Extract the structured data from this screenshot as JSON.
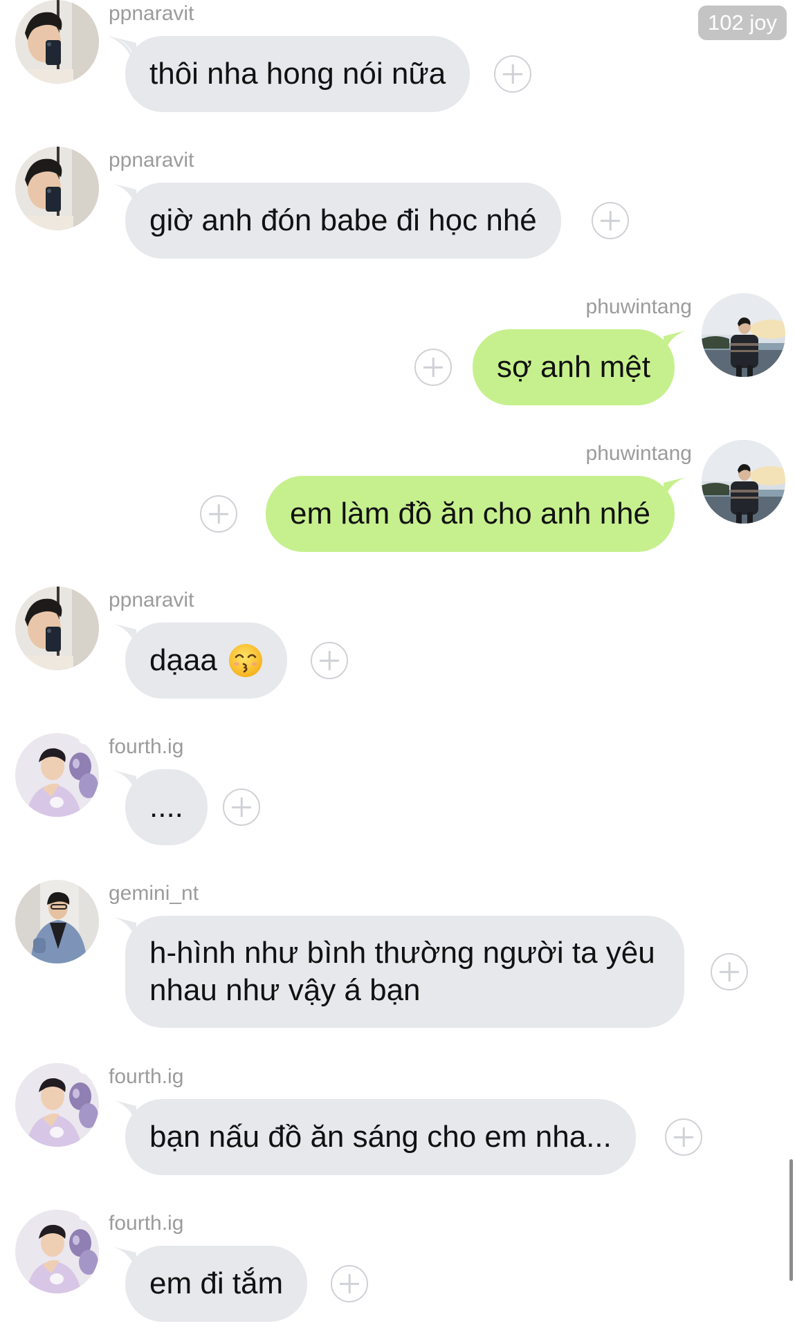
{
  "badge": {
    "text": "102 joy"
  },
  "messages": [
    {
      "user": "ppnaravit",
      "text": "thôi nha hong nói nữa",
      "side": "left",
      "avatar": "ppnaravit-avatar"
    },
    {
      "user": "ppnaravit",
      "text": "giờ anh đón babe đi học nhé",
      "side": "left",
      "avatar": "ppnaravit-avatar"
    },
    {
      "user": "phuwintang",
      "text": "sợ anh mệt",
      "side": "right",
      "avatar": "phuwintang-avatar"
    },
    {
      "user": "phuwintang",
      "text": "em làm đồ ăn cho anh nhé",
      "side": "right",
      "avatar": "phuwintang-avatar"
    },
    {
      "user": "ppnaravit",
      "text": "dạaa",
      "emoji": "kissing-face-with-smiling-eyes",
      "side": "left",
      "avatar": "ppnaravit-avatar"
    },
    {
      "user": "fourth.ig",
      "text": "....",
      "side": "left",
      "avatar": "fourth-avatar"
    },
    {
      "user": "gemini_nt",
      "text": "h-hình như bình thường người ta yêu nhau như vậy á bạn",
      "side": "left",
      "avatar": "gemini-avatar"
    },
    {
      "user": "fourth.ig",
      "text": "bạn nấu đồ ăn sáng cho em nha...",
      "side": "left",
      "avatar": "fourth-avatar"
    },
    {
      "user": "fourth.ig",
      "text": "em đi tắm",
      "side": "left",
      "avatar": "fourth-avatar"
    }
  ],
  "colors": {
    "incoming_bubble": "#e6e8ec",
    "outgoing_bubble": "#c6f08d",
    "username": "#9b9b9b",
    "react_button": "#cfd1d6"
  },
  "icons": {
    "react_button": "add-reaction-icon"
  }
}
